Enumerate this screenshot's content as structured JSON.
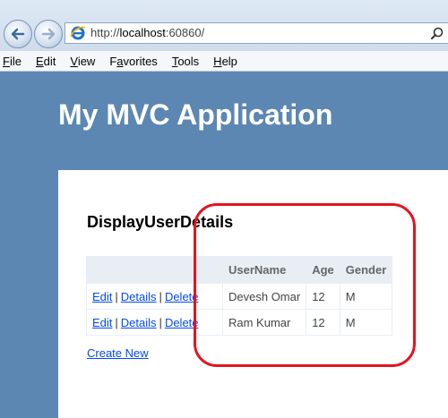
{
  "browser": {
    "url_prefix": "http://",
    "url_host": "localhost",
    "url_rest": ":60860/",
    "menu": [
      {
        "acc": "F",
        "rest": "ile"
      },
      {
        "acc": "E",
        "rest": "dit"
      },
      {
        "acc": "V",
        "rest": "iew"
      },
      {
        "pre": "F",
        "acc": "a",
        "rest": "vorites"
      },
      {
        "acc": "T",
        "rest": "ools"
      },
      {
        "acc": "H",
        "rest": "elp"
      }
    ]
  },
  "site": {
    "title": "My MVC Application"
  },
  "page": {
    "heading": "DisplayUserDetails",
    "table": {
      "headers": [
        "",
        "UserName",
        "Age",
        "Gender"
      ],
      "rows": [
        {
          "edit": "Edit",
          "details": "Details",
          "delete": "Delete",
          "username": "Devesh Omar",
          "age": "12",
          "gender": "M"
        },
        {
          "edit": "Edit",
          "details": "Details",
          "delete": "Delete",
          "username": "Ram Kumar",
          "age": "12",
          "gender": "M"
        }
      ],
      "separator": "|"
    },
    "create_new": "Create New"
  },
  "colors": {
    "background": "#5c87b2",
    "link": "#034af3",
    "highlight": "#e3141f"
  }
}
